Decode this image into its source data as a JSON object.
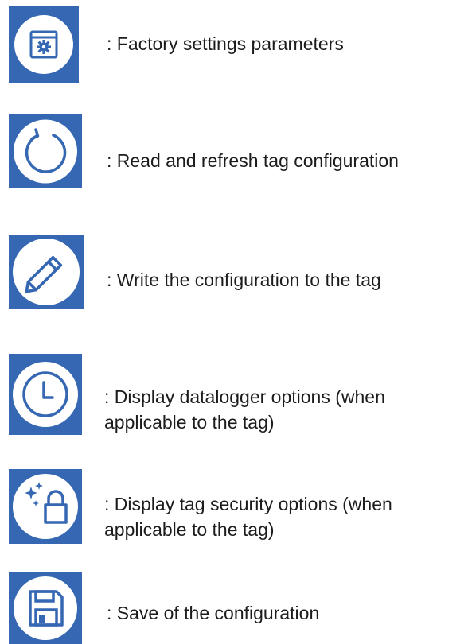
{
  "legend": {
    "colors": {
      "tile": "#3567b3",
      "circle": "#ffffff",
      "glyph": "#3567b3"
    },
    "items": [
      {
        "icon": "factory-settings-icon",
        "text": ": Factory settings parameters"
      },
      {
        "icon": "refresh-icon",
        "text": ": Read and refresh tag configuration"
      },
      {
        "icon": "pencil-icon",
        "text": ": Write the configuration to the tag"
      },
      {
        "icon": "clock-icon",
        "text": ": Display datalogger options (when applicable to the tag)"
      },
      {
        "icon": "lock-sparkle-icon",
        "text": ": Display tag security options (when applicable to the tag)"
      },
      {
        "icon": "floppy-disk-icon",
        "text": ": Save of the configuration"
      }
    ]
  }
}
